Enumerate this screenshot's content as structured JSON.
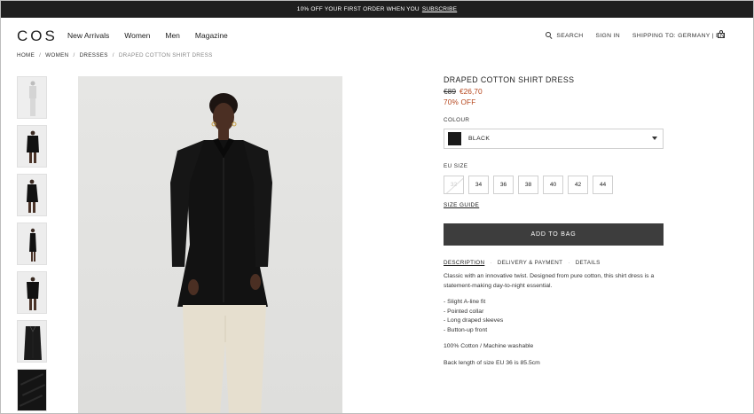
{
  "promo": {
    "text": "10% OFF YOUR FIRST ORDER WHEN YOU",
    "link": "SUBSCRIBE"
  },
  "header": {
    "logo": "COS",
    "nav": [
      "New Arrivals",
      "Women",
      "Men",
      "Magazine"
    ],
    "search_label": "SEARCH",
    "signin_label": "SIGN IN",
    "shipping_label": "SHIPPING TO: GERMANY | EN"
  },
  "breadcrumb": [
    "HOME",
    "WOMEN",
    "DRESSES",
    "DRAPED COTTON SHIRT DRESS"
  ],
  "product": {
    "title": "DRAPED COTTON SHIRT DRESS",
    "old_price": "€89",
    "new_price": "€26,70",
    "discount": "70% OFF",
    "colour_label": "COLOUR",
    "colour_value": "BLACK",
    "size_label": "EU SIZE",
    "sizes": [
      "32",
      "34",
      "36",
      "38",
      "40",
      "42",
      "44"
    ],
    "size_guide": "SIZE GUIDE",
    "add_to_bag": "ADD TO BAG",
    "tabs": [
      "DESCRIPTION",
      "DELIVERY & PAYMENT",
      "DETAILS"
    ],
    "description": "Classic with an innovative twist. Designed from pure cotton, this shirt dress is a statement-making day-to-night essential.",
    "features": [
      "- Slight A-line fit",
      "- Pointed collar",
      "- Long draped sleeves",
      "- Button-up front"
    ],
    "material": "100% Cotton / Machine washable",
    "back_length": "Back length of size EU 36 is 85.5cm"
  },
  "colors": {
    "accent_sale": "#b5451b",
    "button_bg": "#3d3d3d",
    "promo_bg": "#1f1f1f"
  }
}
